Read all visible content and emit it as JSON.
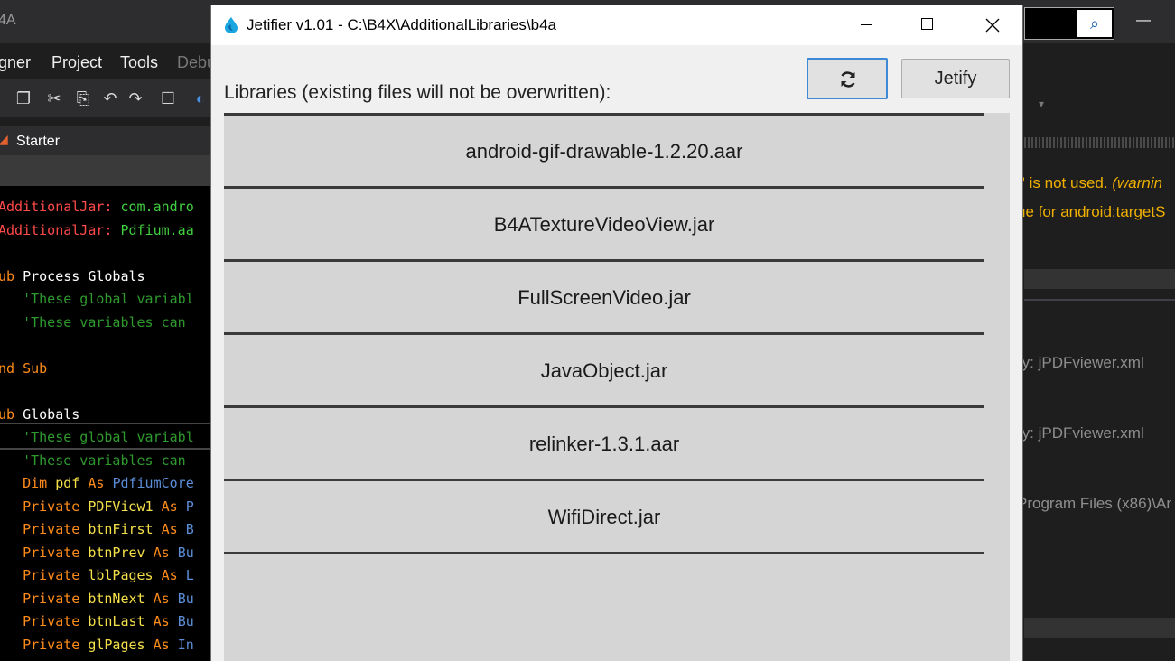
{
  "ide": {
    "title": "4A",
    "menu": [
      "gner",
      "Project",
      "Tools",
      "Debu"
    ],
    "tab": "Starter",
    "code_lines": [
      {
        "parts": [
          {
            "t": "AdditionalJar:",
            "c": "red"
          },
          {
            "t": " com.andro",
            "c": "grn"
          }
        ]
      },
      {
        "parts": [
          {
            "t": "AdditionalJar:",
            "c": "red"
          },
          {
            "t": " Pdfium.aa",
            "c": "grn"
          }
        ]
      },
      {
        "parts": [
          {
            "t": "ub ",
            "c": "org"
          },
          {
            "t": "Process_Globals",
            "c": "wht"
          }
        ]
      },
      {
        "parts": [
          {
            "t": "   'These global variabl",
            "c": "cmt"
          }
        ]
      },
      {
        "parts": [
          {
            "t": "   'These variables can",
            "c": "cmt"
          }
        ]
      },
      {
        "parts": [
          {
            "t": "nd Sub",
            "c": "org"
          }
        ]
      },
      {
        "parts": [
          {
            "t": "ub ",
            "c": "org"
          },
          {
            "t": "Globals",
            "c": "wht"
          }
        ]
      },
      {
        "parts": [
          {
            "t": "   'These global variabl",
            "c": "cmt"
          }
        ]
      },
      {
        "parts": [
          {
            "t": "   'These variables can",
            "c": "cmt"
          }
        ]
      },
      {
        "parts": [
          {
            "t": "   Dim ",
            "c": "org"
          },
          {
            "t": "pdf ",
            "c": "yel"
          },
          {
            "t": "As ",
            "c": "org"
          },
          {
            "t": "PdfiumCore",
            "c": "blu"
          }
        ]
      },
      {
        "parts": [
          {
            "t": "   Private ",
            "c": "org"
          },
          {
            "t": "PDFView1 ",
            "c": "yel"
          },
          {
            "t": "As ",
            "c": "org"
          },
          {
            "t": "P",
            "c": "blu"
          }
        ]
      },
      {
        "parts": [
          {
            "t": "   Private ",
            "c": "org"
          },
          {
            "t": "btnFirst ",
            "c": "yel"
          },
          {
            "t": "As ",
            "c": "org"
          },
          {
            "t": "B",
            "c": "blu"
          }
        ]
      },
      {
        "parts": [
          {
            "t": "   Private ",
            "c": "org"
          },
          {
            "t": "btnPrev ",
            "c": "yel"
          },
          {
            "t": "As ",
            "c": "org"
          },
          {
            "t": "Bu",
            "c": "blu"
          }
        ]
      },
      {
        "parts": [
          {
            "t": "   Private ",
            "c": "org"
          },
          {
            "t": "lblPages ",
            "c": "yel"
          },
          {
            "t": "As ",
            "c": "org"
          },
          {
            "t": "L",
            "c": "blu"
          }
        ]
      },
      {
        "parts": [
          {
            "t": "   Private ",
            "c": "org"
          },
          {
            "t": "btnNext ",
            "c": "yel"
          },
          {
            "t": "As ",
            "c": "org"
          },
          {
            "t": "Bu",
            "c": "blu"
          }
        ]
      },
      {
        "parts": [
          {
            "t": "   Private ",
            "c": "org"
          },
          {
            "t": "btnLast ",
            "c": "yel"
          },
          {
            "t": "As ",
            "c": "org"
          },
          {
            "t": "Bu",
            "c": "blu"
          }
        ]
      },
      {
        "parts": [
          {
            "t": "   Private ",
            "c": "org"
          },
          {
            "t": "glPages ",
            "c": "yel"
          },
          {
            "t": "As ",
            "c": "org"
          },
          {
            "t": "In",
            "c": "blu"
          }
        ]
      }
    ],
    "right_panel": {
      "warning_1": "r' is not used.",
      "warning_1_tag": "(warnin",
      "warning_2": "ue for android:targetS",
      "bracket_1": "]",
      "log_1": "ry: jPDFviewer.xml",
      "bracket_2": "]",
      "log_2": "ry: jPDFviewer.xml",
      "bracket_3": "]",
      "log_3": "Program Files (x86)\\Ar"
    }
  },
  "dialog": {
    "title": "Jetifier v1.01 - C:\\B4X\\AdditionalLibraries\\b4a",
    "libraries_label": "Libraries (existing files will not be overwritten):",
    "jetify_label": "Jetify",
    "libraries": [
      "android-gif-drawable-1.2.20.aar",
      "B4ATextureVideoView.jar",
      "FullScreenVideo.jar",
      "JavaObject.jar",
      "relinker-1.3.1.aar",
      "WifiDirect.jar"
    ]
  },
  "icons": {
    "refresh": "refresh-icon",
    "search": "search-icon",
    "app_logo": "jetifier-logo-icon",
    "minimize": "minimize-icon",
    "maximize": "maximize-icon",
    "close": "close-icon"
  },
  "colors": {
    "accent": "#3c8ad6",
    "list_bg": "#d5d5d5",
    "warning": "#f0b000"
  }
}
